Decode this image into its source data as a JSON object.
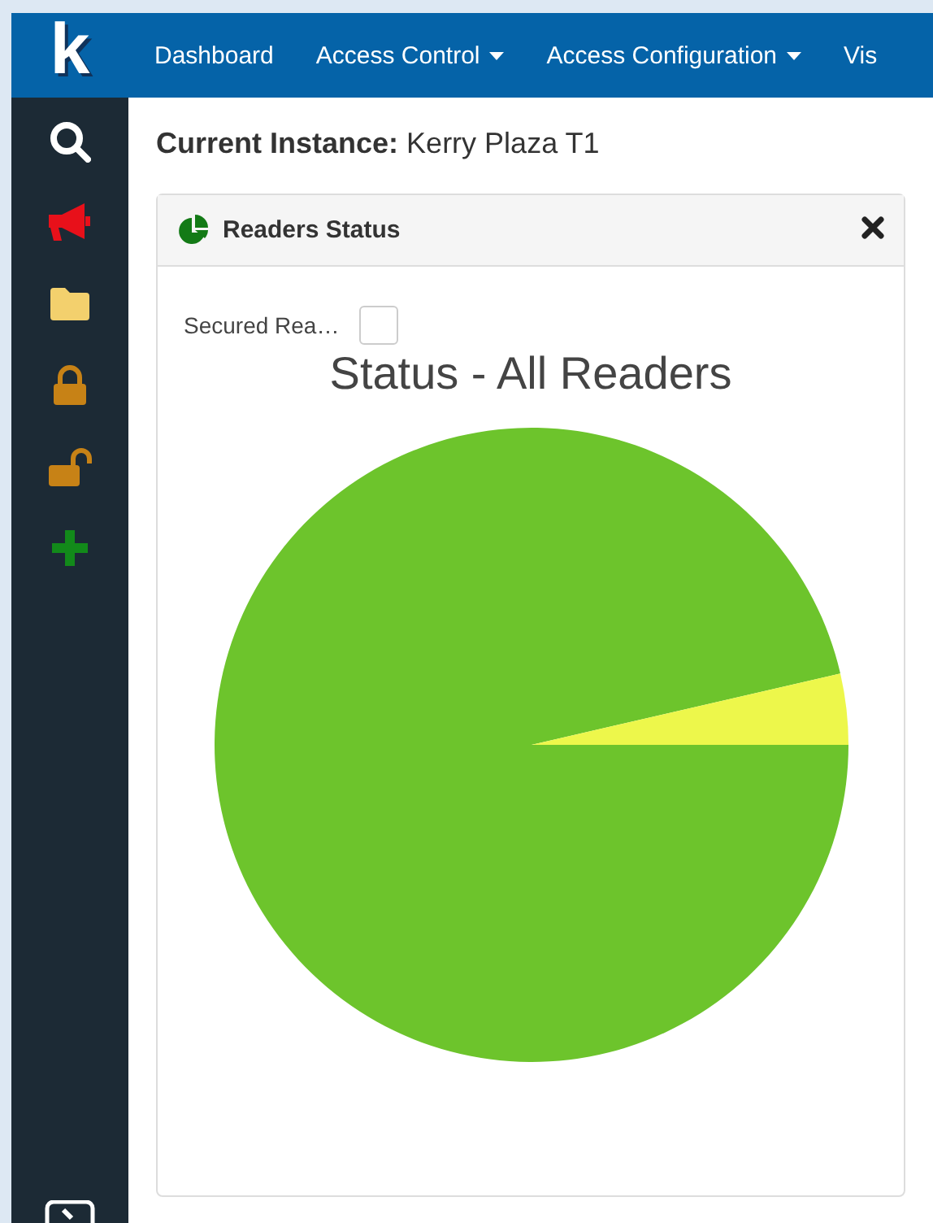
{
  "logo": {
    "text": "k"
  },
  "nav": {
    "items": [
      {
        "label": "Dashboard",
        "dropdown": false
      },
      {
        "label": "Access Control",
        "dropdown": true
      },
      {
        "label": "Access Configuration",
        "dropdown": true
      },
      {
        "label": "Vis",
        "dropdown": false
      }
    ]
  },
  "sidebar": {
    "items": [
      {
        "kind": "search"
      },
      {
        "kind": "megaphone"
      },
      {
        "kind": "folder"
      },
      {
        "kind": "lock"
      },
      {
        "kind": "unlock"
      },
      {
        "kind": "plus"
      }
    ]
  },
  "instance": {
    "label": "Current Instance:",
    "value": "Kerry Plaza T1"
  },
  "widget": {
    "title": "Readers Status",
    "filter": {
      "label": "Secured Rea…",
      "checked": false
    },
    "chart_title": "Status - All Readers"
  }
}
